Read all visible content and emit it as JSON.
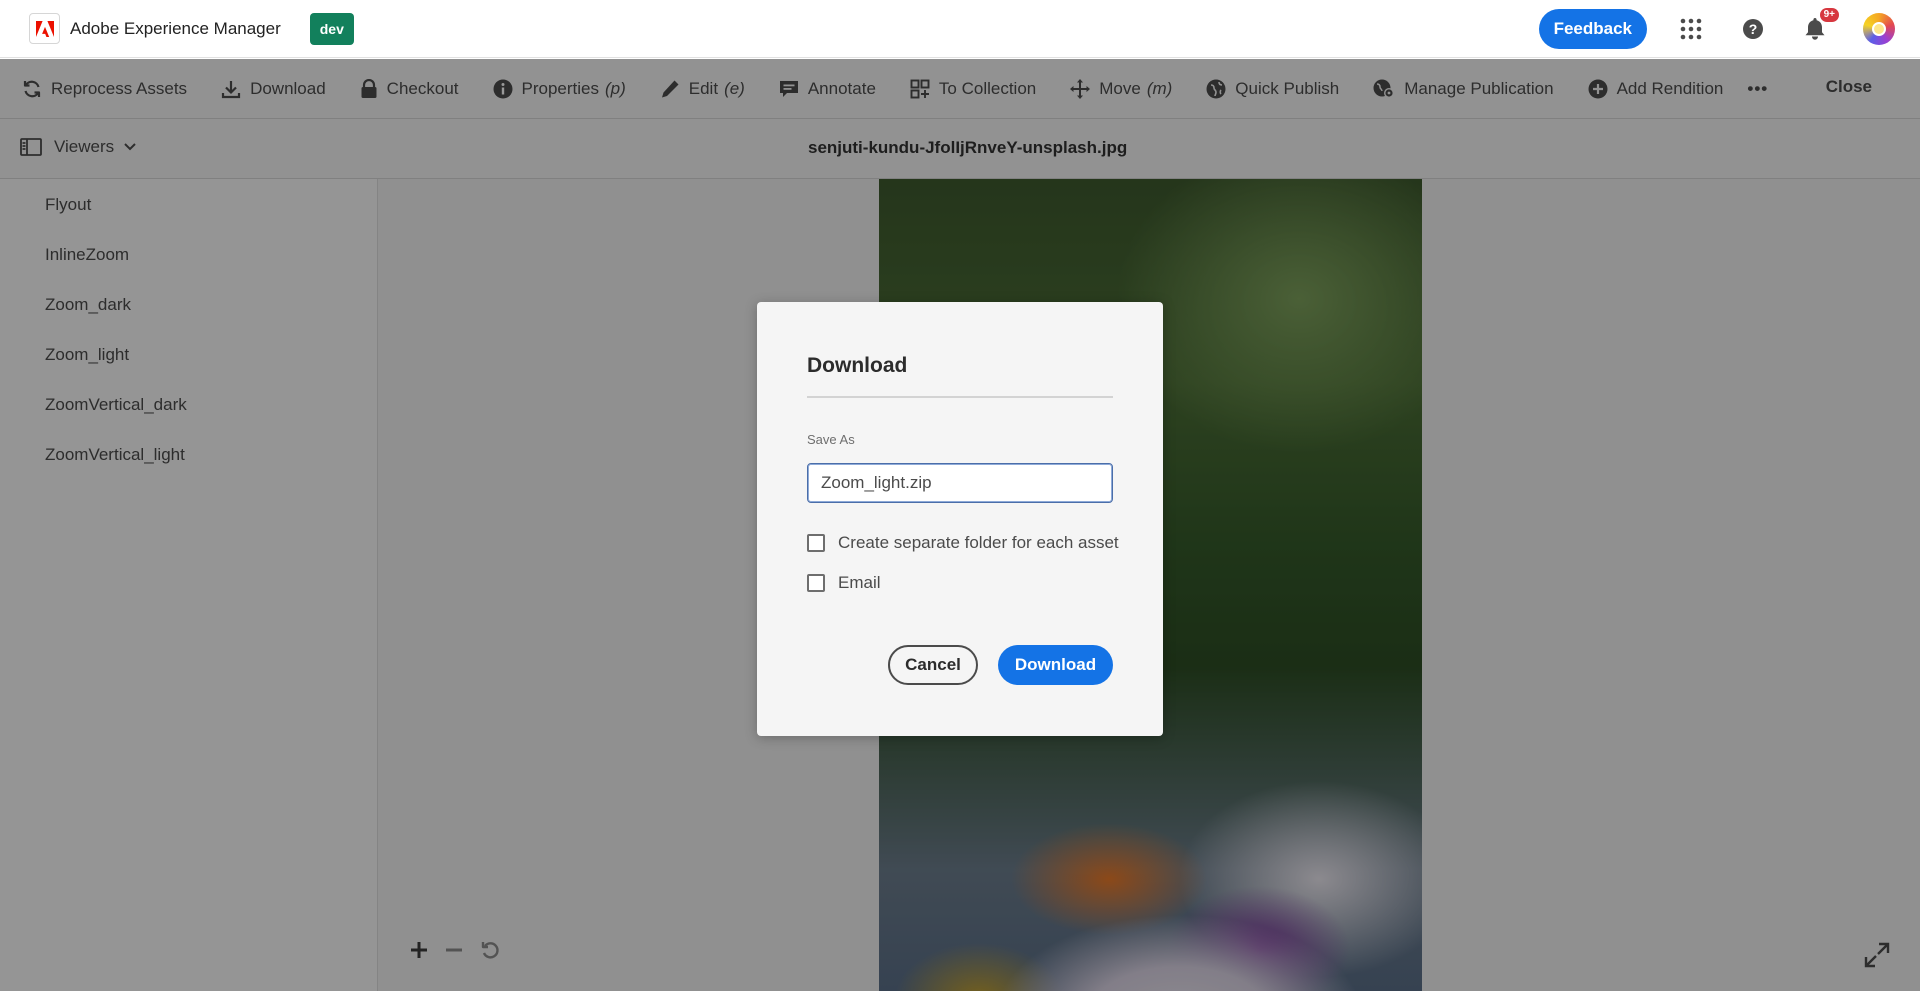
{
  "header": {
    "app_name": "Adobe Experience Manager",
    "env_badge": "dev",
    "feedback_label": "Feedback",
    "notification_count": "9+",
    "icons": [
      "adobe-logo",
      "apps-grid-icon",
      "help-icon",
      "bell-icon",
      "avatar"
    ]
  },
  "toolbar": {
    "reprocess": "Reprocess Assets",
    "download": "Download",
    "checkout": "Checkout",
    "properties": "Properties",
    "properties_key": "(p)",
    "edit": "Edit",
    "edit_key": "(e)",
    "annotate": "Annotate",
    "to_collection": "To Collection",
    "move": "Move",
    "move_key": "(m)",
    "quick_publish": "Quick Publish",
    "manage_publication": "Manage Publication",
    "add_rendition": "Add Rendition",
    "more": "•••",
    "close": "Close"
  },
  "titlebar": {
    "viewers_label": "Viewers",
    "file_name": "senjuti-kundu-JfolIjRnveY-unsplash.jpg"
  },
  "viewers": [
    "Flyout",
    "InlineZoom",
    "Zoom_dark",
    "Zoom_light",
    "ZoomVertical_dark",
    "ZoomVertical_light"
  ],
  "dialog": {
    "title": "Download",
    "save_as_label": "Save As",
    "save_as_value": "Zoom_light.zip",
    "option_separate_folder": "Create separate folder for each asset",
    "option_email": "Email",
    "cancel_label": "Cancel",
    "download_label": "Download"
  },
  "colors": {
    "accent": "#1473e6",
    "env_badge": "#12805c",
    "notification": "#d7373f"
  }
}
